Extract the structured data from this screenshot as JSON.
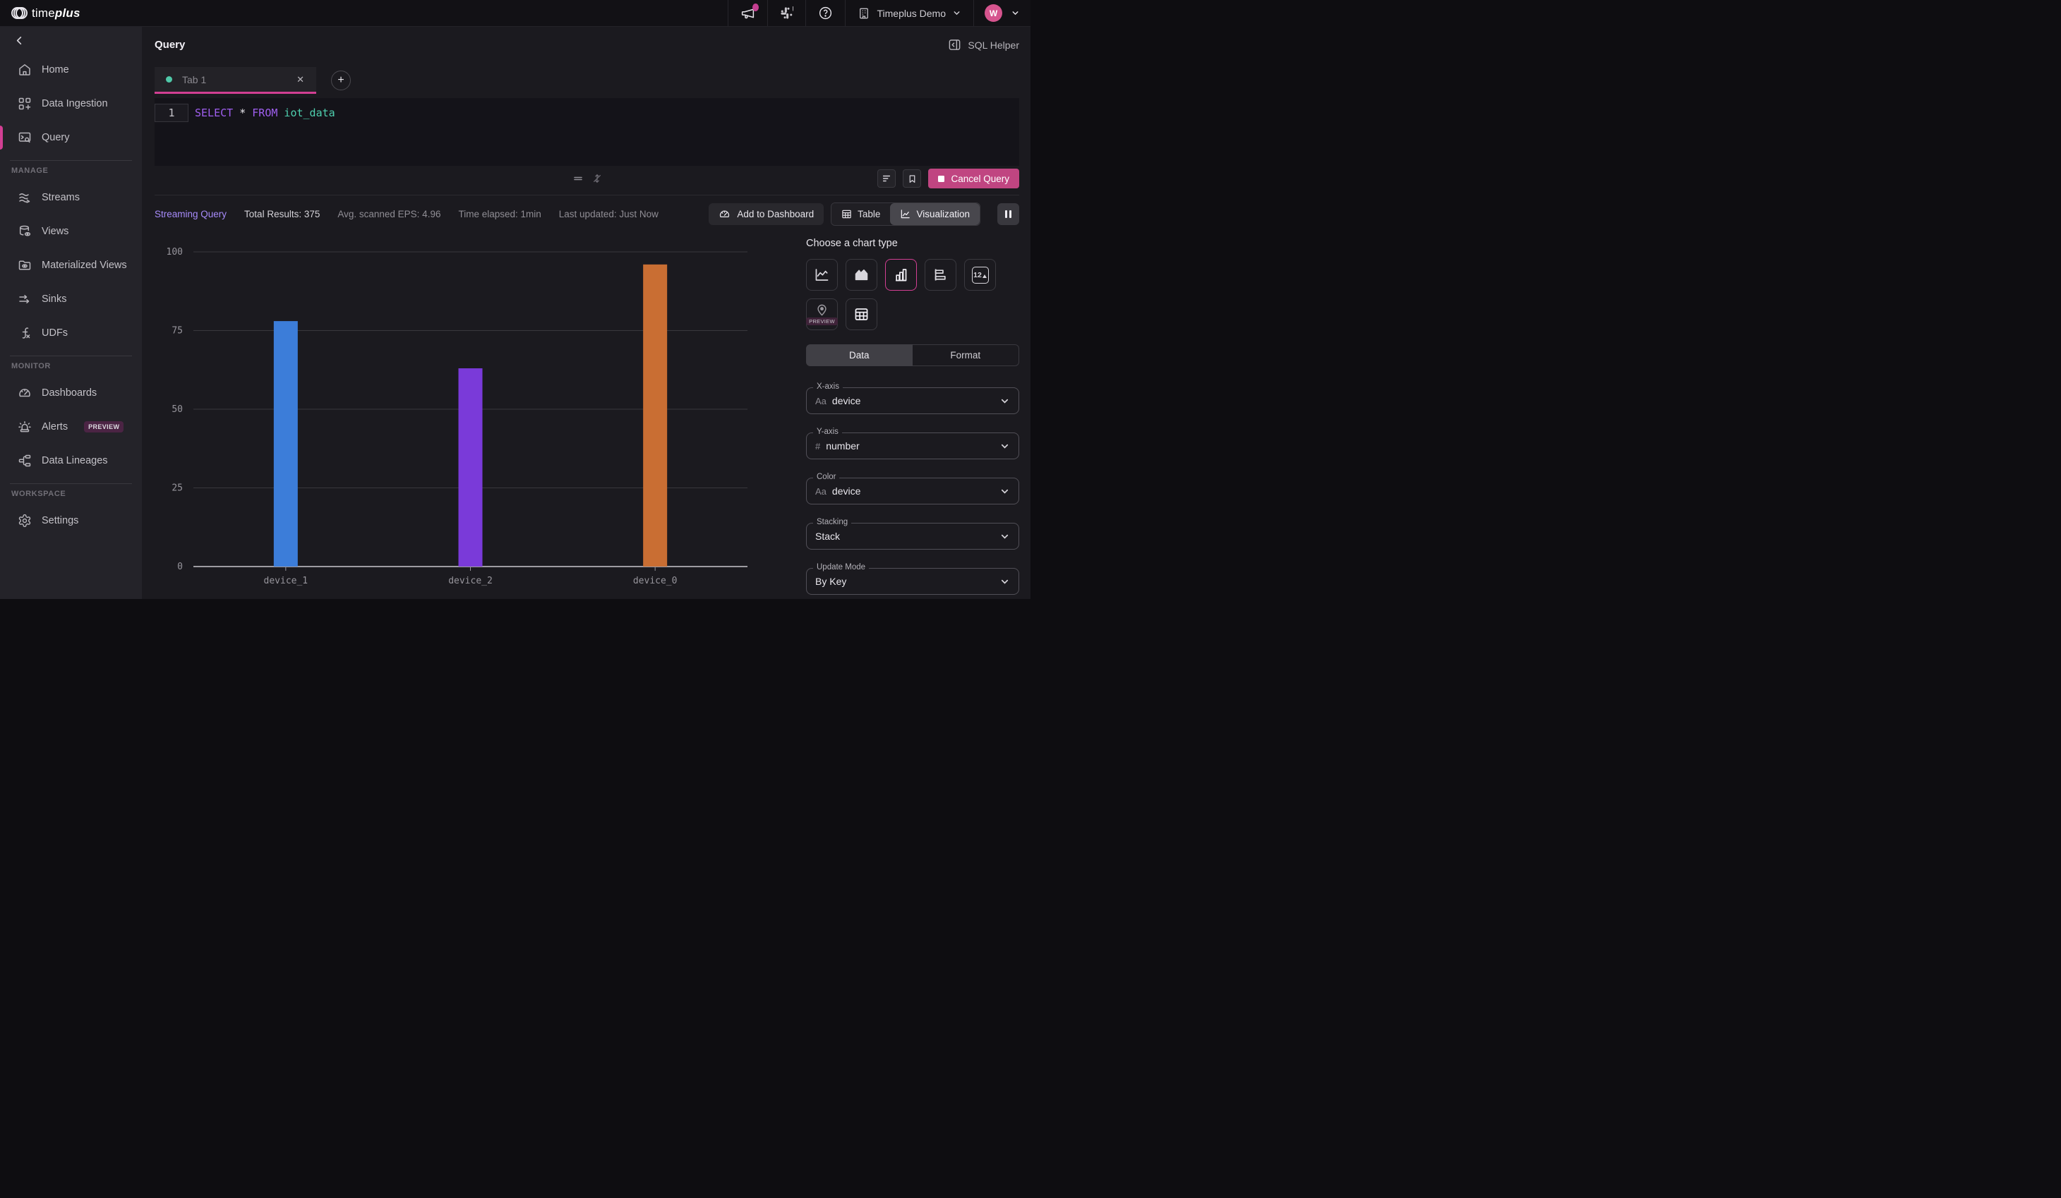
{
  "topbar": {
    "brand_time": "time",
    "brand_plus": "plus",
    "workspace_label": "Timeplus Demo",
    "avatar_initial": "W"
  },
  "page": {
    "title": "Query",
    "sql_helper_label": "SQL Helper"
  },
  "tabs": {
    "active_tab_label": "Tab 1",
    "close_label": "✕",
    "new_tab_label": "+"
  },
  "editor": {
    "line_number": "1",
    "kw_select": "SELECT",
    "star": " * ",
    "kw_from": "FROM",
    "table_name": " iot_data",
    "cancel_label": "Cancel Query"
  },
  "status": {
    "streaming_label": "Streaming Query",
    "total_results": "Total Results: 375",
    "avg_eps": "Avg. scanned EPS: 4.96",
    "time_elapsed": "Time elapsed: 1min",
    "last_updated": "Last updated: Just Now"
  },
  "actions": {
    "add_to_dashboard": "Add to Dashboard",
    "table_label": "Table",
    "visualization_label": "Visualization"
  },
  "sidebar": {
    "groups": [
      {
        "label": "",
        "items": [
          {
            "label": "Home"
          },
          {
            "label": "Data Ingestion"
          },
          {
            "label": "Query",
            "active": true
          }
        ]
      },
      {
        "label": "MANAGE",
        "items": [
          {
            "label": "Streams"
          },
          {
            "label": "Views"
          },
          {
            "label": "Materialized Views"
          },
          {
            "label": "Sinks"
          },
          {
            "label": "UDFs"
          }
        ]
      },
      {
        "label": "MONITOR",
        "items": [
          {
            "label": "Dashboards"
          },
          {
            "label": "Alerts",
            "badge": "PREVIEW"
          },
          {
            "label": "Data Lineages"
          }
        ]
      },
      {
        "label": "WORKSPACE",
        "items": [
          {
            "label": "Settings"
          }
        ]
      }
    ]
  },
  "panel": {
    "title": "Choose a chart type",
    "tab_data": "Data",
    "tab_format": "Format",
    "single_value_label": "12",
    "map_preview_badge": "PREVIEW",
    "fields": [
      {
        "label": "X-axis",
        "type_icon": "Aa",
        "value": "device"
      },
      {
        "label": "Y-axis",
        "type_icon": "#",
        "value": "number"
      },
      {
        "label": "Color",
        "type_icon": "Aa",
        "value": "device"
      },
      {
        "label": "Stacking",
        "value": "Stack"
      },
      {
        "label": "Update Mode",
        "value": "By Key"
      }
    ]
  },
  "colors": {
    "accent_pink": "#d23f93",
    "cancel_button": "#c04581",
    "streaming_text": "#a78bfa",
    "sql_keyword": "#a05ff0",
    "sql_identifier": "#4ecfae",
    "tab_dot": "#4fc8a8",
    "avatar_bg": "#d6548e",
    "gridline": "#39383d",
    "axis_line": "#c9c7cd"
  },
  "chart_data": {
    "type": "bar",
    "title": "",
    "categories": [
      "device_1",
      "device_2",
      "device_0"
    ],
    "values": [
      78,
      63,
      96
    ],
    "series_colors": [
      "#3c7dd9",
      "#7a3ad9",
      "#c96e33"
    ],
    "xlabel": "device",
    "ylabel": "number",
    "ylim": [
      0,
      100
    ],
    "yticks": [
      0,
      25,
      50,
      75,
      100
    ],
    "grid": true,
    "legend": false
  }
}
